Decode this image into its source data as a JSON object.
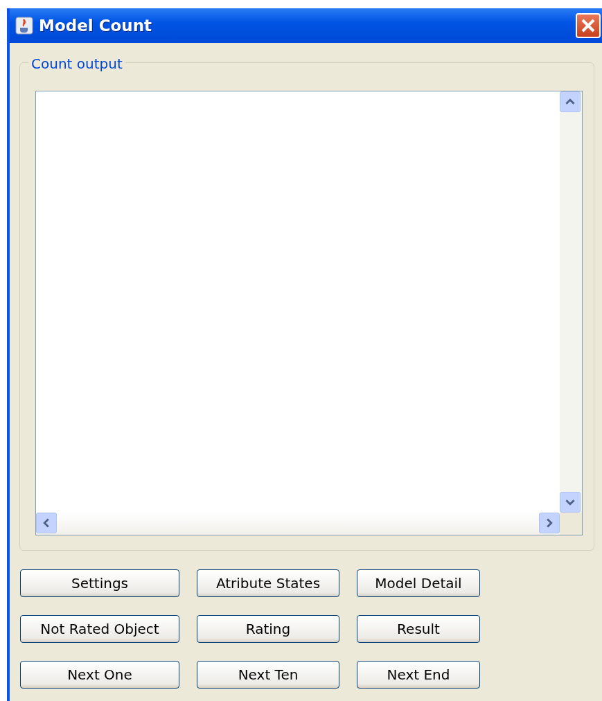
{
  "window": {
    "title": "Model Count"
  },
  "output_group": {
    "label": "Count output"
  },
  "buttons": [
    [
      "Settings",
      "Atribute States",
      "Model Detail"
    ],
    [
      "Not Rated Object",
      "Rating",
      "Result"
    ],
    [
      "Next One",
      "Next Ten",
      "Next End"
    ]
  ]
}
